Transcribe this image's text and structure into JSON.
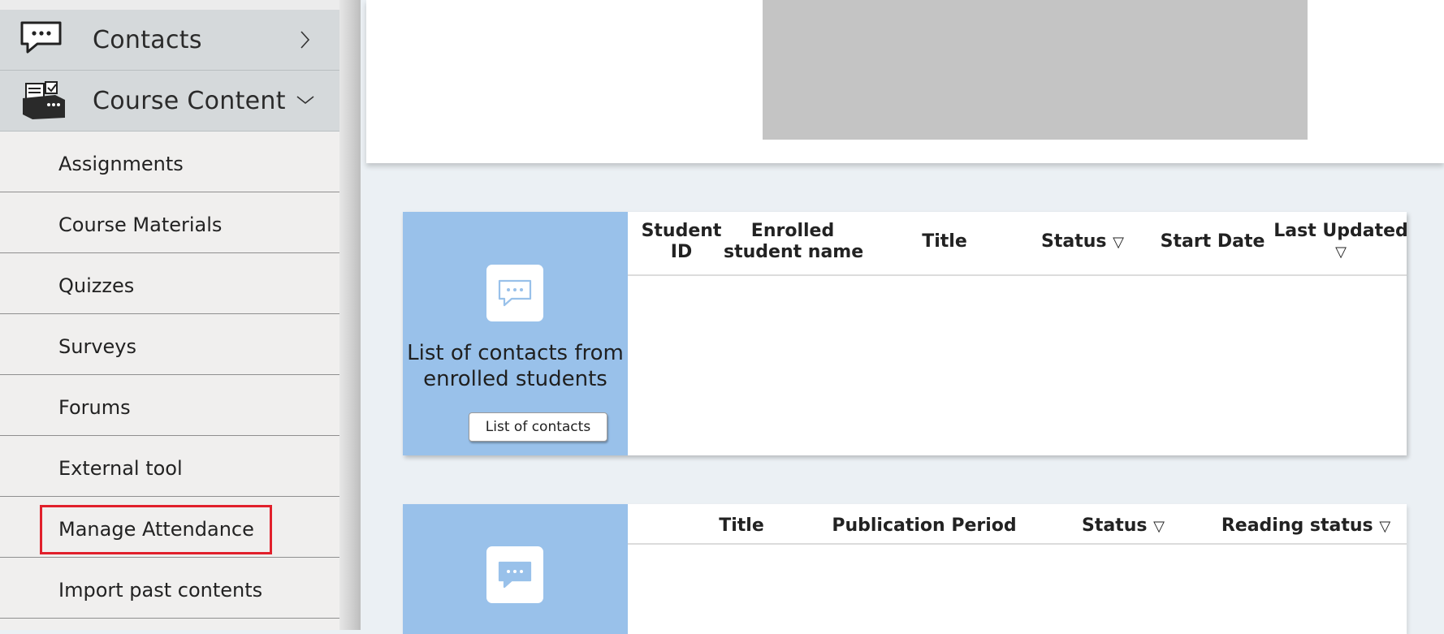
{
  "sidebar": {
    "contacts": {
      "label": "Contacts"
    },
    "course_content": {
      "label": "Course Content",
      "items": [
        {
          "label": "Assignments"
        },
        {
          "label": "Course Materials"
        },
        {
          "label": "Quizzes"
        },
        {
          "label": "Surveys"
        },
        {
          "label": "Forums"
        },
        {
          "label": "External tool"
        },
        {
          "label": "Manage Attendance"
        },
        {
          "label": "Import past contents"
        }
      ]
    }
  },
  "contacts_widget": {
    "description": "List of contacts from enrolled students",
    "button": "List of contacts",
    "columns": {
      "student_id_1": "Student",
      "student_id_2": "ID",
      "enrolled_1": "Enrolled",
      "enrolled_2": "student name",
      "title": "Title",
      "status": "Status",
      "start_date": "Start Date",
      "last_updated": "Last Updated",
      "sort_glyph": "▽"
    }
  },
  "announcements_widget": {
    "columns": {
      "title": "Title",
      "publication_period": "Publication Period",
      "status": "Status",
      "reading_status": "Reading status",
      "sort_glyph": "▽"
    }
  },
  "colors": {
    "sidebar_bg": "#f0efee",
    "nav_header_bg": "#d5d9db",
    "widget_accent": "#99c1ea",
    "highlight": "#e1202b",
    "page_bg": "#ebf0f4"
  }
}
